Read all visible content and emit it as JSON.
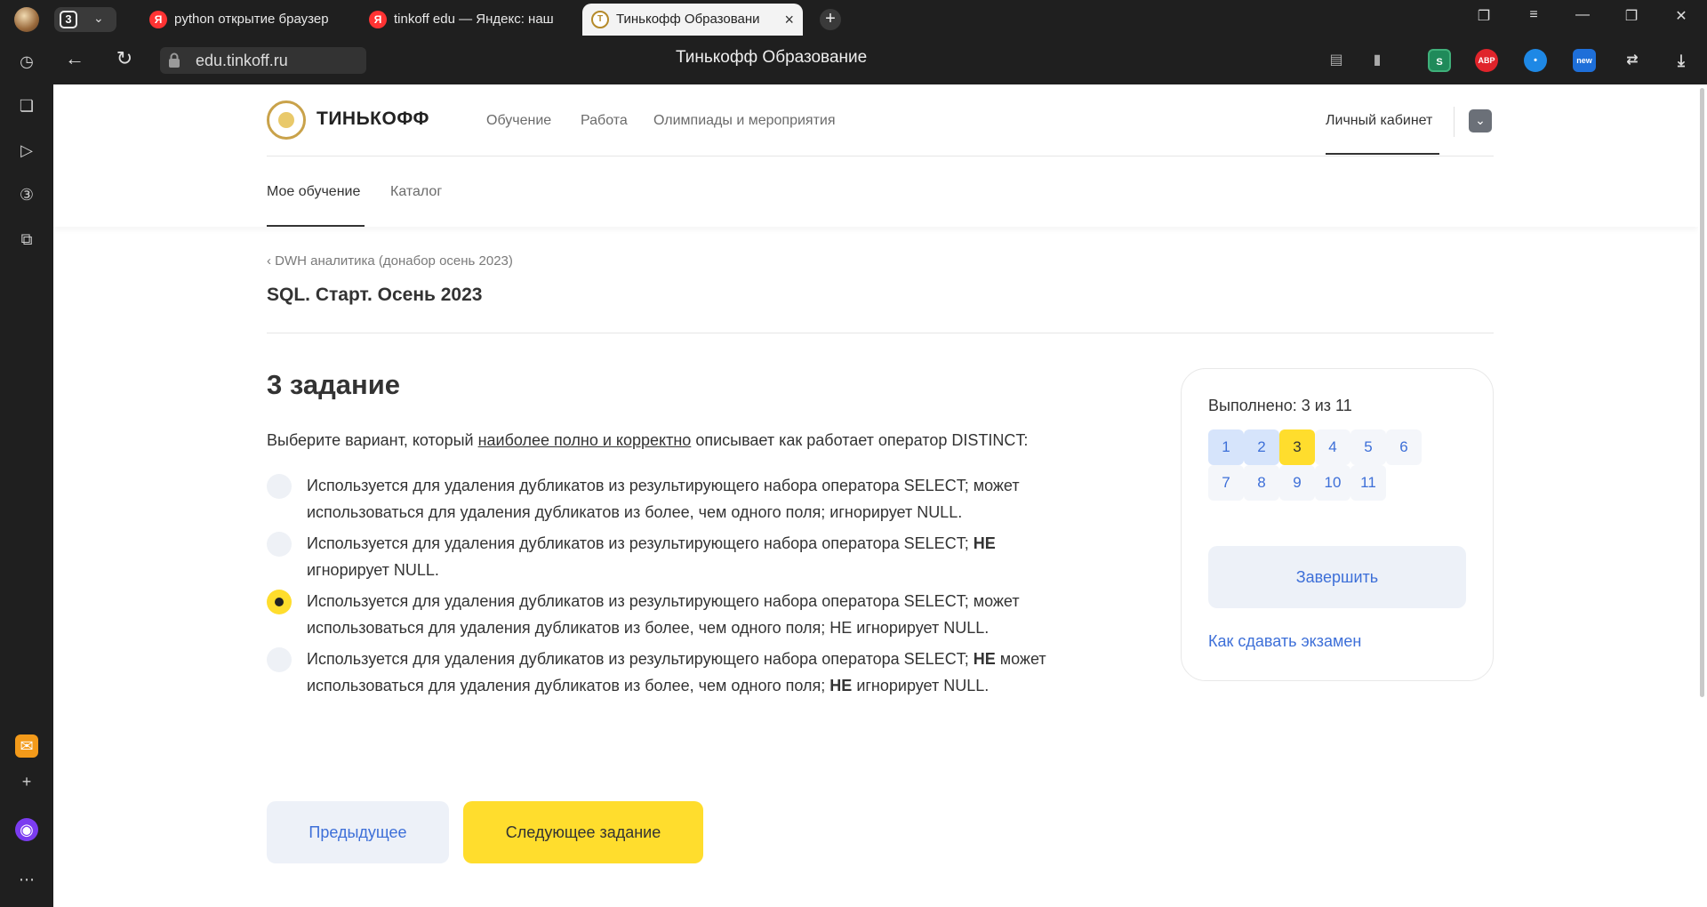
{
  "browser": {
    "tab_count": "3",
    "tabs": [
      {
        "label": "python открытие браузер",
        "favicon": "Я"
      },
      {
        "label": "tinkoff edu — Яндекс: наш",
        "favicon": "Я"
      },
      {
        "label": "Тинькофф Образовани",
        "favicon": "T"
      }
    ],
    "url": "edu.tinkoff.ru",
    "page_title": "Тинькофф Образование",
    "extensions": [
      "S",
      "ABP",
      "•",
      "new"
    ]
  },
  "header": {
    "brand": "ТИНЬКОФФ",
    "nav": [
      "Обучение",
      "Работа",
      "Олимпиады и мероприятия"
    ],
    "cabinet": "Личный кабинет",
    "subnav": [
      "Мое обучение",
      "Каталог"
    ]
  },
  "breadcrumb": "DWH аналитика (донабор осень 2023)",
  "course_title": "SQL. Старт. Осень 2023",
  "task": {
    "title": "3 задание",
    "question": {
      "before": "Выберите вариант, который ",
      "underlined": "наиболее полно и корректно",
      "after": " описывает как работает оператор DISTINCT:"
    },
    "options": [
      {
        "parts": [
          "Используется для удаления дубликатов из результирующего набора оператора SELECT; может использоваться для удаления дубликатов из более, чем одного поля; игнорирует NULL."
        ],
        "selected": false
      },
      {
        "parts": [
          "Используется для удаления дубликатов из результирующего набора оператора SELECT; ",
          "НЕ",
          " игнорирует NULL."
        ],
        "selected": false
      },
      {
        "parts": [
          "Используется для удаления дубликатов из результирующего набора оператора SELECT; может использоваться для удаления дубликатов из более, чем одного поля; НЕ игнорирует NULL."
        ],
        "selected": true
      },
      {
        "parts": [
          "Используется для удаления дубликатов из результирующего набора оператора SELECT; ",
          "НЕ",
          " может использоваться для удаления дубликатов из более, чем одного поля; ",
          "НЕ",
          " игнорирует NULL."
        ],
        "selected": false
      }
    ],
    "prev_label": "Предыдущее",
    "next_label": "Следующее задание"
  },
  "sidebar": {
    "progress": "Выполнено: 3 из 11",
    "questions": [
      "1",
      "2",
      "3",
      "4",
      "5",
      "6",
      "7",
      "8",
      "9",
      "10",
      "11"
    ],
    "finish_label": "Завершить",
    "howto_link": "Как сдавать экзамен"
  },
  "colors": {
    "accent_yellow": "#ffdd2d",
    "link_blue": "#3d6fd8",
    "button_bg": "#edf1f8"
  }
}
